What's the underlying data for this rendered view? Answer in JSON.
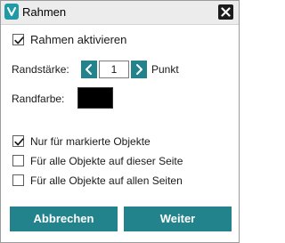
{
  "window": {
    "title": "Rahmen",
    "app_icon": "app-logo-icon",
    "close_icon": "close-icon"
  },
  "enable_frame": {
    "label": "Rahmen aktivieren",
    "checked": true
  },
  "border_width": {
    "label": "Randstärke:",
    "value": "1",
    "unit": "Punkt",
    "decrement_icon": "chevron-left-icon",
    "increment_icon": "chevron-right-icon"
  },
  "border_color": {
    "label": "Randfarbe:",
    "color": "#000000"
  },
  "scope_options": [
    {
      "label": "Nur für markierte Objekte",
      "checked": true
    },
    {
      "label": "Für alle Objekte auf dieser Seite",
      "checked": false
    },
    {
      "label": "Für alle Objekte auf allen Seiten",
      "checked": false
    }
  ],
  "buttons": {
    "cancel": "Abbrechen",
    "continue": "Weiter"
  },
  "colors": {
    "accent": "#23838d",
    "title_bar": "#ececec"
  }
}
